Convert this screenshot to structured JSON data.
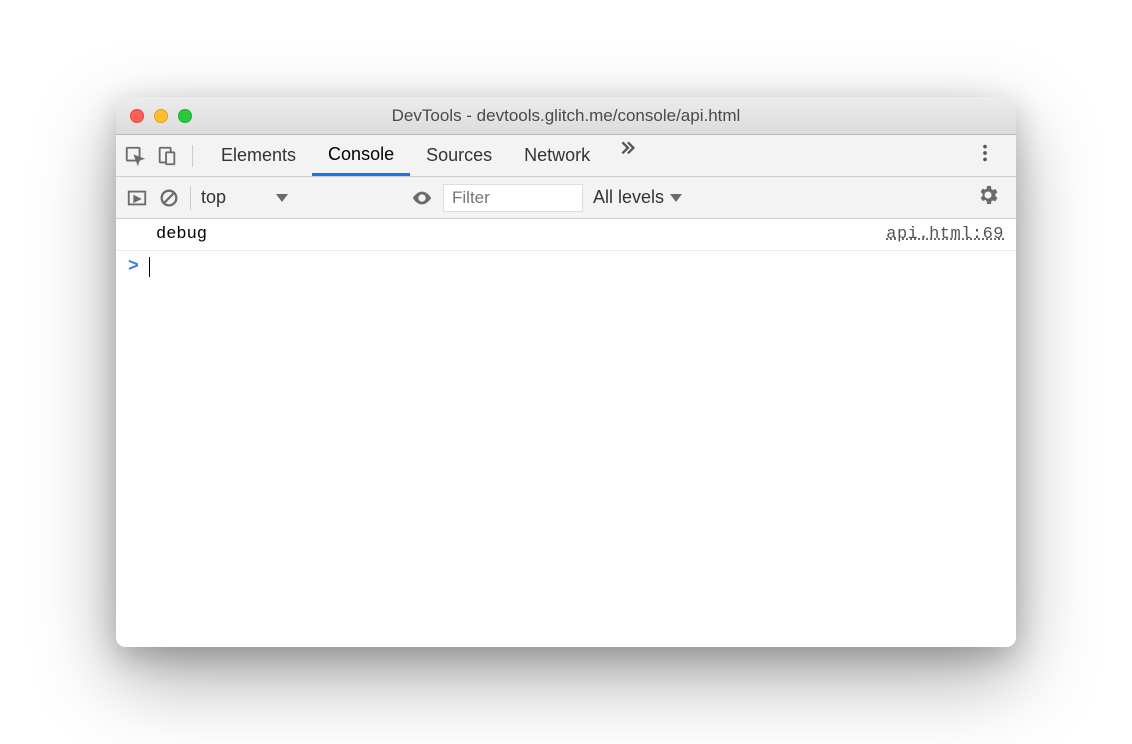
{
  "window": {
    "title": "DevTools - devtools.glitch.me/console/api.html"
  },
  "tabs": {
    "items": [
      "Elements",
      "Console",
      "Sources",
      "Network"
    ],
    "activeIndex": 1
  },
  "toolbar": {
    "context": "top",
    "filterPlaceholder": "Filter",
    "levels": "All levels"
  },
  "console": {
    "rows": [
      {
        "message": "debug",
        "source": "api.html:69"
      }
    ],
    "prompt": ">"
  }
}
